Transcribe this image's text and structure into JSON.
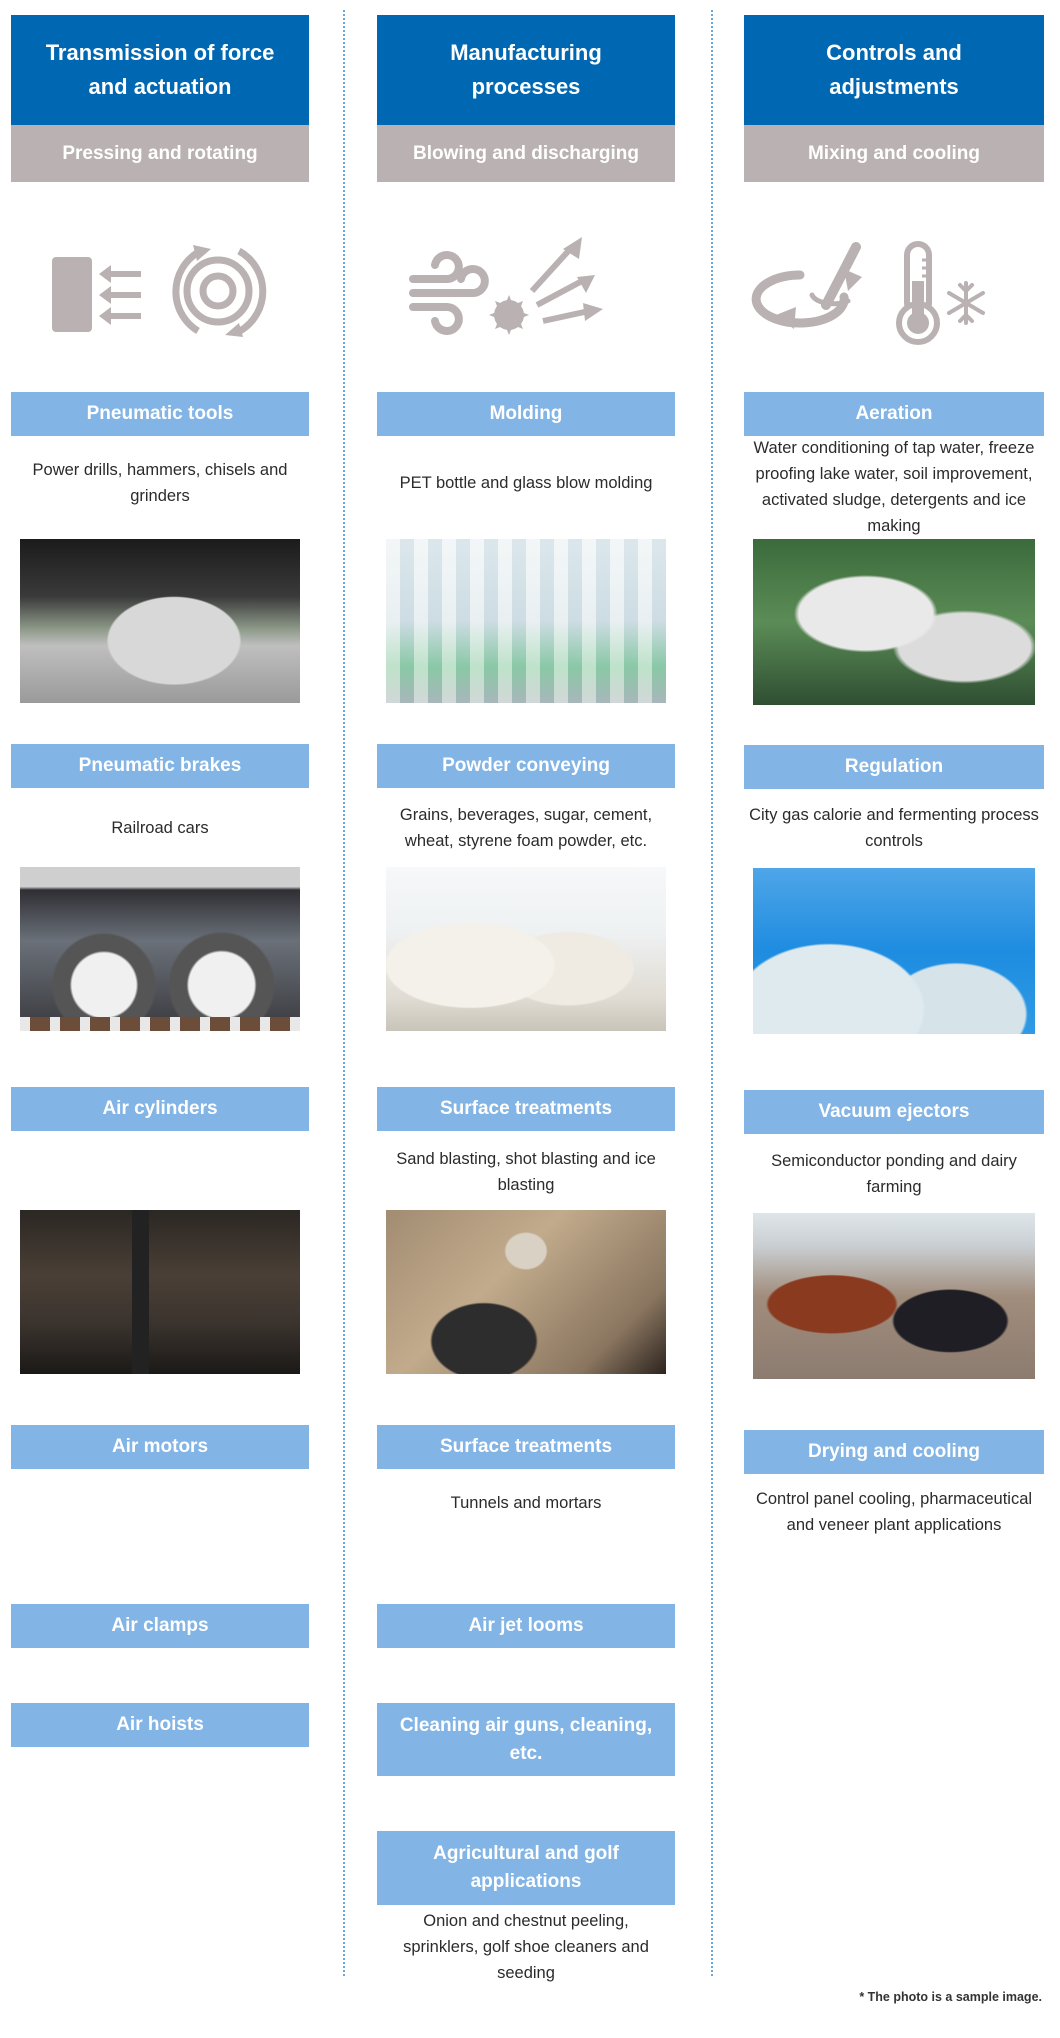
{
  "columns": [
    {
      "title": "Transmission of force and actuation",
      "subtitle": "Pressing and rotating",
      "icon_names": [
        "pressing-icon",
        "rotating-icon"
      ],
      "items": [
        {
          "label": "Pneumatic tools",
          "description": "Power drills, hammers, chisels and grinders",
          "photo": "drill-press-photo"
        },
        {
          "label": "Pneumatic brakes",
          "description": "Railroad cars",
          "photo": "railroad-car-photo"
        },
        {
          "label": "Air cylinders",
          "description": "",
          "photo": "air-cylinders-photo"
        },
        {
          "label": "Air motors",
          "description": ""
        },
        {
          "label": "Air clamps",
          "description": ""
        },
        {
          "label": "Air hoists",
          "description": ""
        }
      ]
    },
    {
      "title": "Manufacturing processes",
      "subtitle": "Blowing and discharging",
      "icon_names": [
        "wind-icon",
        "burst-icon"
      ],
      "items": [
        {
          "label": "Molding",
          "description": "PET bottle and glass blow molding",
          "photo": "bottles-photo"
        },
        {
          "label": "Powder conveying",
          "description": "Grains, beverages, sugar, cement, wheat, styrene foam powder, etc.",
          "photo": "sacks-photo"
        },
        {
          "label": "Surface treatments",
          "description": "Sand blasting, shot blasting and ice blasting",
          "photo": "sand-blasting-photo"
        },
        {
          "label": "Surface treatments",
          "description": "Tunnels and mortars"
        },
        {
          "label": "Air jet looms",
          "description": ""
        },
        {
          "label": "Cleaning air guns, cleaning, etc.",
          "description": ""
        },
        {
          "label": "Agricultural and golf applications",
          "description": "Onion and chestnut peeling, sprinklers, golf shoe cleaners and seeding"
        }
      ]
    },
    {
      "title": "Controls and adjustments",
      "subtitle": "Mixing and cooling",
      "icon_names": [
        "mixing-icon",
        "thermometer-icon",
        "snowflake-icon"
      ],
      "items": [
        {
          "label": "Aeration",
          "description": "Water conditioning of tap water, freeze proofing lake water, soil improvement, activated sludge, detergents and ice making",
          "photo": "aeration-foam-photo"
        },
        {
          "label": "Regulation",
          "description": "City gas calorie and fermenting process controls",
          "photo": "gas-tanks-photo"
        },
        {
          "label": "Vacuum ejectors",
          "description": "Semiconductor ponding and dairy farming",
          "photo": "dairy-cows-photo"
        },
        {
          "label": "Drying and cooling",
          "description": "Control panel cooling, pharmaceutical and veneer plant applications"
        }
      ]
    }
  ],
  "footnote": "* The photo is a sample image.",
  "colors": {
    "header_blue": "#0068b3",
    "subheader_gray": "#bab2b2",
    "label_blue": "#82b4e5",
    "icon_gray": "#bab2b2",
    "divider_blue": "#6aa8dd"
  }
}
